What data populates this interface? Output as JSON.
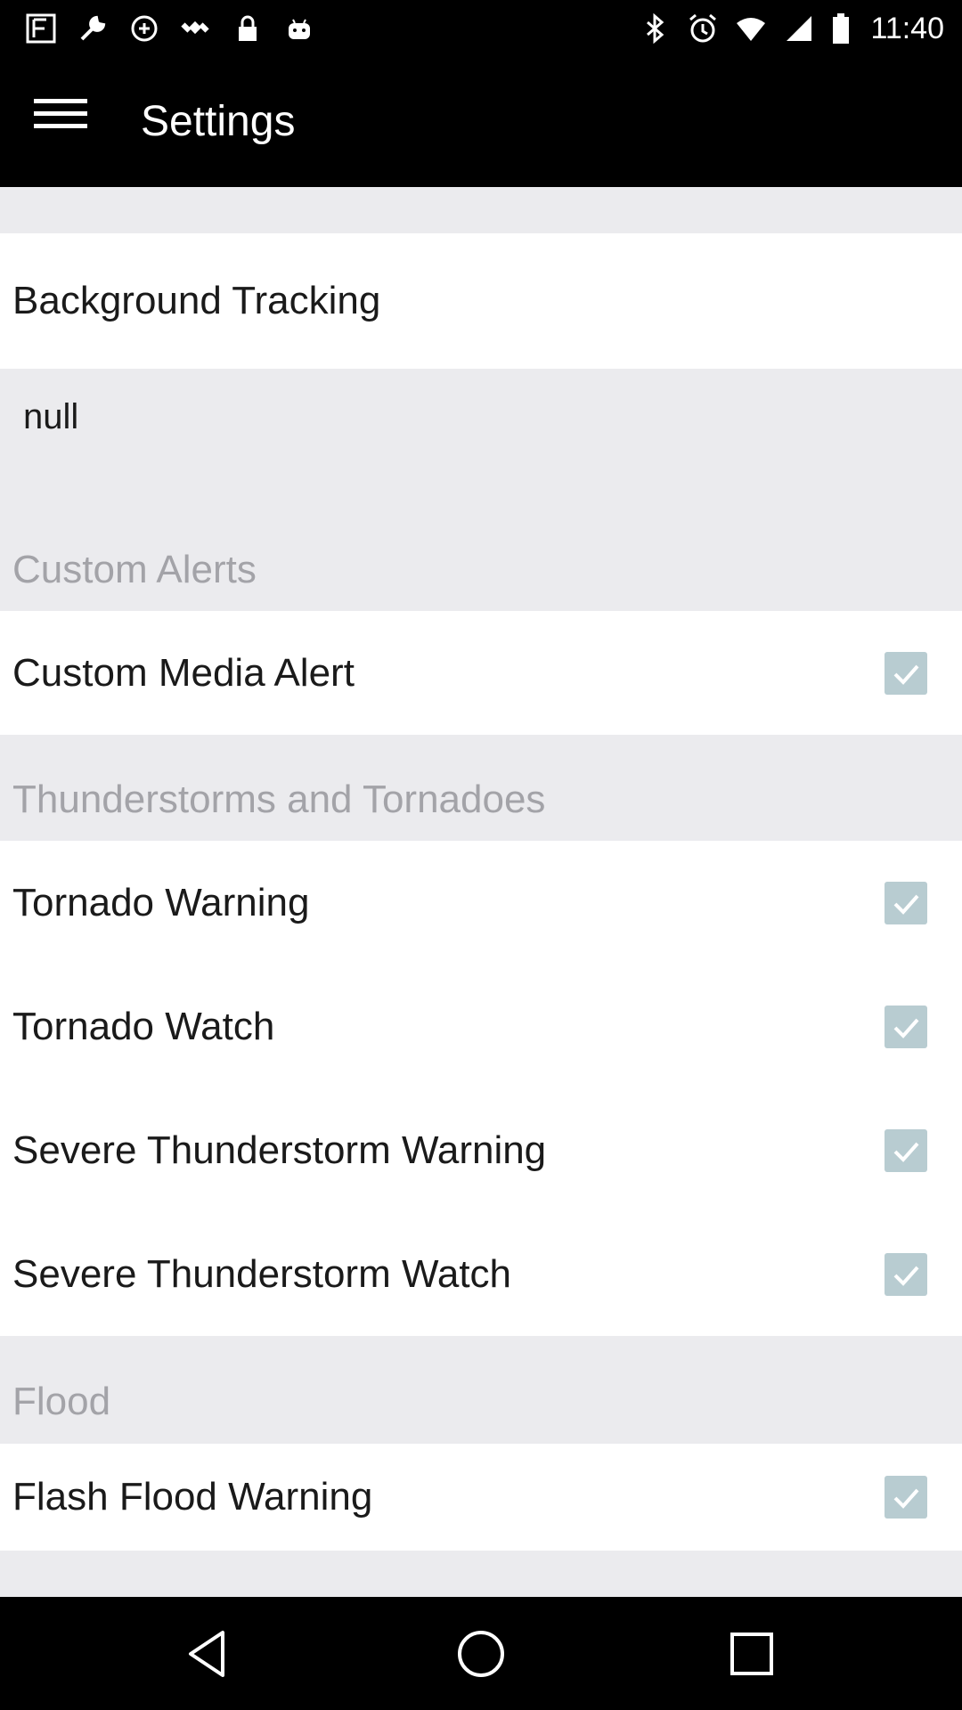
{
  "status_bar": {
    "time": "11:40",
    "left_icons": [
      "notification-icon",
      "wrench-icon",
      "sync-icon",
      "satellite-icon",
      "lock-icon",
      "android-icon"
    ],
    "right_icons": [
      "bluetooth-icon",
      "alarm-icon",
      "wifi-icon",
      "signal-icon",
      "battery-icon"
    ]
  },
  "app_bar": {
    "title": "Settings"
  },
  "settings": {
    "background_tracking_label": "Background Tracking",
    "null_text": "null",
    "custom_alerts_header": "Custom Alerts",
    "custom_media_alert_label": "Custom Media Alert",
    "thunderstorms_header": "Thunderstorms and Tornadoes",
    "items": [
      {
        "label": "Tornado Warning",
        "checked": true
      },
      {
        "label": "Tornado Watch",
        "checked": true
      },
      {
        "label": "Severe Thunderstorm Warning",
        "checked": true
      },
      {
        "label": "Severe Thunderstorm Watch",
        "checked": true
      }
    ],
    "flood_header": "Flood",
    "flash_flood_label": "Flash Flood Warning"
  },
  "nav_bar": {
    "buttons": [
      "back-icon",
      "home-icon",
      "recents-icon"
    ]
  },
  "colors": {
    "background": "#ebebee",
    "section_text": "#a3a3a8",
    "checkbox": "#b8ccd1"
  }
}
